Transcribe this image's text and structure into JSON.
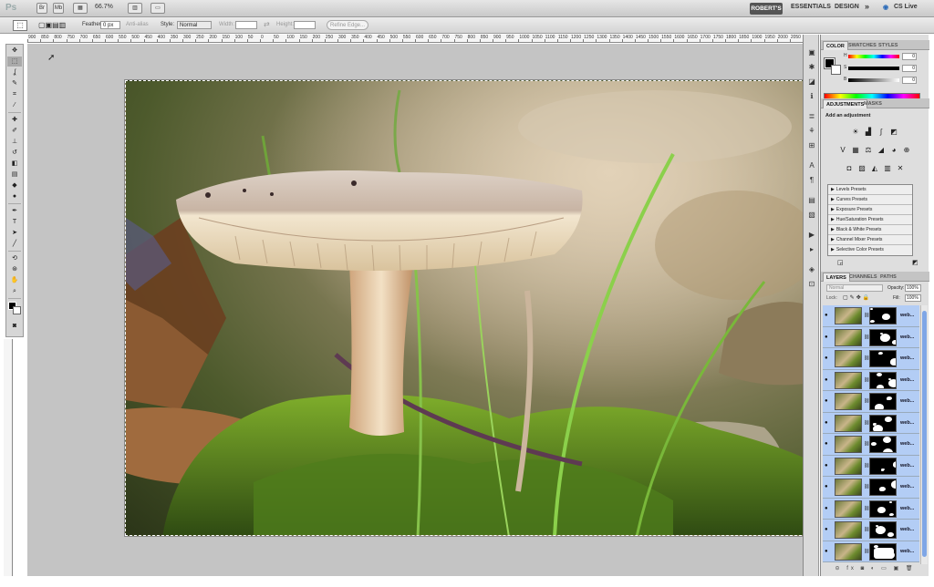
{
  "appbar": {
    "logo": "Ps",
    "zoom": "66.7%",
    "workspace_active": "ROBERT'S",
    "workspace_essentials": "ESSENTIALS",
    "workspace_design": "DESIGN",
    "more": "»",
    "cs_live": "CS Live"
  },
  "options": {
    "feather_label": "Feather:",
    "feather_value": "0 px",
    "antialias_label": "Anti-alias",
    "style_label": "Style:",
    "style_value": "Normal",
    "width_label": "Width:",
    "height_label": "Height:",
    "refine_edge": "Refine Edge..."
  },
  "ruler": {
    "ticks": [
      "900",
      "850",
      "800",
      "750",
      "700",
      "650",
      "600",
      "550",
      "500",
      "450",
      "400",
      "350",
      "300",
      "250",
      "200",
      "150",
      "100",
      "50",
      "0",
      "50",
      "100",
      "150",
      "200",
      "250",
      "300",
      "350",
      "400",
      "450",
      "500",
      "550",
      "600",
      "650",
      "700",
      "750",
      "800",
      "850",
      "900",
      "950",
      "1000",
      "1050",
      "1100",
      "1150",
      "1200",
      "1250",
      "1300",
      "1350",
      "1400",
      "1450",
      "1500",
      "1550",
      "1600",
      "1650",
      "1700",
      "1750",
      "1800",
      "1850",
      "1900",
      "1950",
      "2000",
      "2050"
    ]
  },
  "color_panel": {
    "tabs": [
      "COLOR",
      "SWATCHES",
      "STYLES"
    ],
    "h_label": "H",
    "h_value": "0",
    "s_label": "S",
    "s_value": "0",
    "b_label": "B",
    "b_value": "0",
    "unit": "%"
  },
  "adjustments_panel": {
    "tabs": [
      "ADJUSTMENTS",
      "MASKS"
    ],
    "title": "Add an adjustment",
    "presets": [
      "Levels Presets",
      "Curves Presets",
      "Exposure Presets",
      "Hue/Saturation Presets",
      "Black & White Presets",
      "Channel Mixer Presets",
      "Selective Color Presets"
    ]
  },
  "layers_panel": {
    "tabs": [
      "LAYERS",
      "CHANNELS",
      "PATHS"
    ],
    "blend_mode": "Normal",
    "opacity_label": "Opacity:",
    "opacity_value": "100%",
    "lock_label": "Lock:",
    "fill_label": "Fill:",
    "fill_value": "100%",
    "layer_names": [
      "web...",
      "web...",
      "web...",
      "web...",
      "web...",
      "web...",
      "web...",
      "web...",
      "web...",
      "web...",
      "web...",
      "web..."
    ]
  },
  "colors": {
    "canvas_bg": "#c4c4c4",
    "selected_layer": "#b3cdf5",
    "panel_bg": "#dedede"
  }
}
